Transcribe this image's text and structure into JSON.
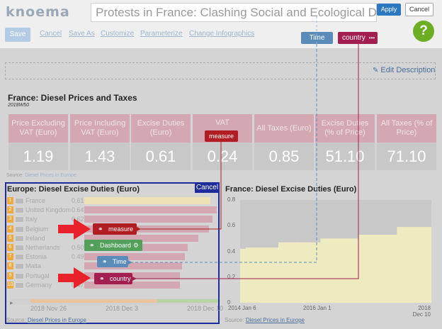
{
  "header": {
    "logo": "knoema",
    "title": "Protests in France: Clashing Social and Ecological Demands",
    "apply_label": "Apply",
    "cancel_label": "Cancel",
    "help_label": "?"
  },
  "toolbar": {
    "save_label": "Save",
    "links": [
      "Cancel",
      "Save As",
      "Customize",
      "Parameterize",
      "Change Infographics"
    ]
  },
  "dimension_chips": {
    "time": "Time",
    "country": "country",
    "country_more": "•••"
  },
  "description": {
    "edit_label": "Edit Description"
  },
  "price_section": {
    "title": "France: Diesel Prices and Taxes",
    "subtitle": "2018W50",
    "tiles": [
      {
        "label": "Price Excluding VAT (Euro)",
        "value": "1.19"
      },
      {
        "label": "Price Including VAT (Euro)",
        "value": "1.43"
      },
      {
        "label": "Excise Duties (Euro)",
        "value": "0.61"
      },
      {
        "label": "VAT",
        "value": "0.24"
      },
      {
        "label": "All Taxes (Euro)",
        "value": "0.85"
      },
      {
        "label": "Excise Duties (% of Price)",
        "value": "51.10"
      },
      {
        "label": "All Taxes (% of Price)",
        "value": "71.10"
      }
    ],
    "source_prefix": "Source:",
    "source_link": "Diesel Prices in Europe",
    "measure_chip": "measure"
  },
  "left_chart": {
    "title": "Europe: Diesel Excise Duties (Euro)",
    "cancel_label": "Cancel",
    "rows": [
      {
        "rank": "1",
        "country": "France",
        "value": "0.61",
        "fraction": 0.83,
        "highlight": true
      },
      {
        "rank": "2",
        "country": "United Kingdom",
        "value": "0.64",
        "fraction": 0.87,
        "highlight": false
      },
      {
        "rank": "3",
        "country": "Italy",
        "value": "0.62",
        "fraction": 0.84,
        "highlight": false
      },
      {
        "rank": "4",
        "country": "Belgium",
        "value": "0.60",
        "fraction": 0.82,
        "highlight": false
      },
      {
        "rank": "5",
        "country": "Ireland",
        "value": "",
        "fraction": 0.75,
        "highlight": false
      },
      {
        "rank": "6",
        "country": "Netherlands",
        "value": "0.50",
        "fraction": 0.68,
        "highlight": false
      },
      {
        "rank": "7",
        "country": "Estonia",
        "value": "0.49",
        "fraction": 0.66,
        "highlight": false
      },
      {
        "rank": "8",
        "country": "Malta",
        "value": "",
        "fraction": 0.64,
        "highlight": false
      },
      {
        "rank": "9",
        "country": "Portugal",
        "value": "",
        "fraction": 0.63,
        "highlight": false
      },
      {
        "rank": "10",
        "country": "Germany",
        "value": "0.47",
        "fraction": 0.63,
        "highlight": false
      }
    ],
    "timeline_labels": [
      "2018 Nov 26",
      "2018 Dec 3",
      "2018 Dec 10"
    ],
    "source_prefix": "Source:",
    "source_link": "Diesel Prices in Europe"
  },
  "overlay_chips": {
    "measure": "measure",
    "dashboard": "Dashboard",
    "time": "Time",
    "country": "country"
  },
  "right_chart": {
    "title": "France: Diesel Excise Duties (Euro)",
    "source_prefix": "Source:",
    "source_link": "Diesel Prices in Europe"
  },
  "chart_data": {
    "type": "area",
    "title": "France: Diesel Excise Duties (Euro)",
    "xlabel": "",
    "ylabel": "",
    "x": [
      "2014 Jan 6",
      "2014 Mar",
      "2015 Jan",
      "2015 Jul",
      "2016 Jan 1",
      "2016 Jul",
      "2017 Jan",
      "2018 Jan",
      "2018 Dec 10"
    ],
    "values": [
      0.42,
      0.43,
      0.47,
      0.47,
      0.5,
      0.5,
      0.53,
      0.59,
      0.61
    ],
    "ylim": [
      0,
      0.8
    ],
    "yticks": [
      "0.8",
      "0.6",
      "0.4",
      "0.2",
      "0"
    ],
    "xticks": [
      "2014 Jan 6",
      "2016 Jan 1",
      "2018 Dec 10"
    ],
    "grid": false
  },
  "colors": {
    "accent_blue": "#2b77c0",
    "measure_red": "#b01e23",
    "country_maroon": "#a21f4f",
    "time_blue": "#5b8bb9",
    "dashboard_green": "#52a05a",
    "help_green": "#6cad23",
    "arrow_red": "#e8212a",
    "panel_border": "#1d2c9a",
    "area_fill": "#eeebc0"
  },
  "icons": [
    "pencil-icon",
    "link-icon",
    "gear-icon",
    "play-icon",
    "flag-icon",
    "arrow-icon"
  ]
}
